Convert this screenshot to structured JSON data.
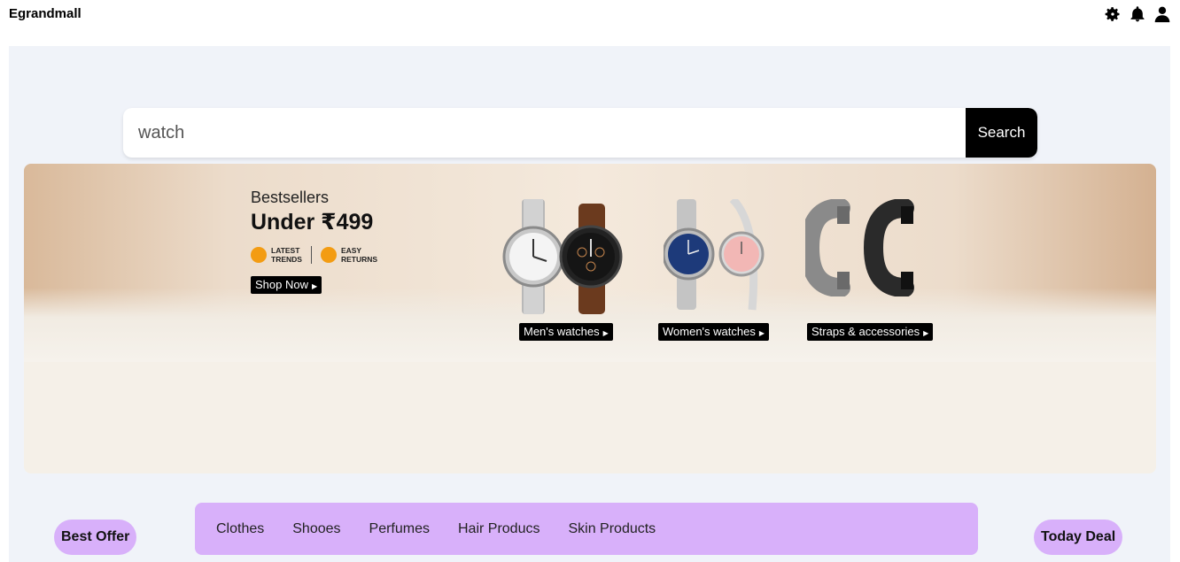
{
  "header": {
    "brand": "Egrandmall",
    "icons": [
      "gear-icon",
      "bell-icon",
      "user-icon"
    ]
  },
  "search": {
    "value": "watch",
    "placeholder": "",
    "button_label": "Search"
  },
  "banner": {
    "subtitle": "Bestsellers",
    "headline": "Under ₹499",
    "badges": [
      {
        "line1": "LATEST",
        "line2": "TRENDS"
      },
      {
        "line1": "EASY",
        "line2": "RETURNS"
      }
    ],
    "shop_now": "Shop Now",
    "categories": [
      {
        "label": "Men's watches"
      },
      {
        "label": "Women's watches"
      },
      {
        "label": "Straps & accessories"
      }
    ]
  },
  "bottom": {
    "best_offer": "Best Offer",
    "today_deal": "Today Deal",
    "categories": [
      "Clothes",
      "Shooes",
      "Perfumes",
      "Hair Producs",
      "Skin Products"
    ]
  },
  "colors": {
    "accent": "#d8b0fa",
    "page_bg": "#f0f3f9",
    "button": "#000000",
    "badge": "#f39c12"
  }
}
